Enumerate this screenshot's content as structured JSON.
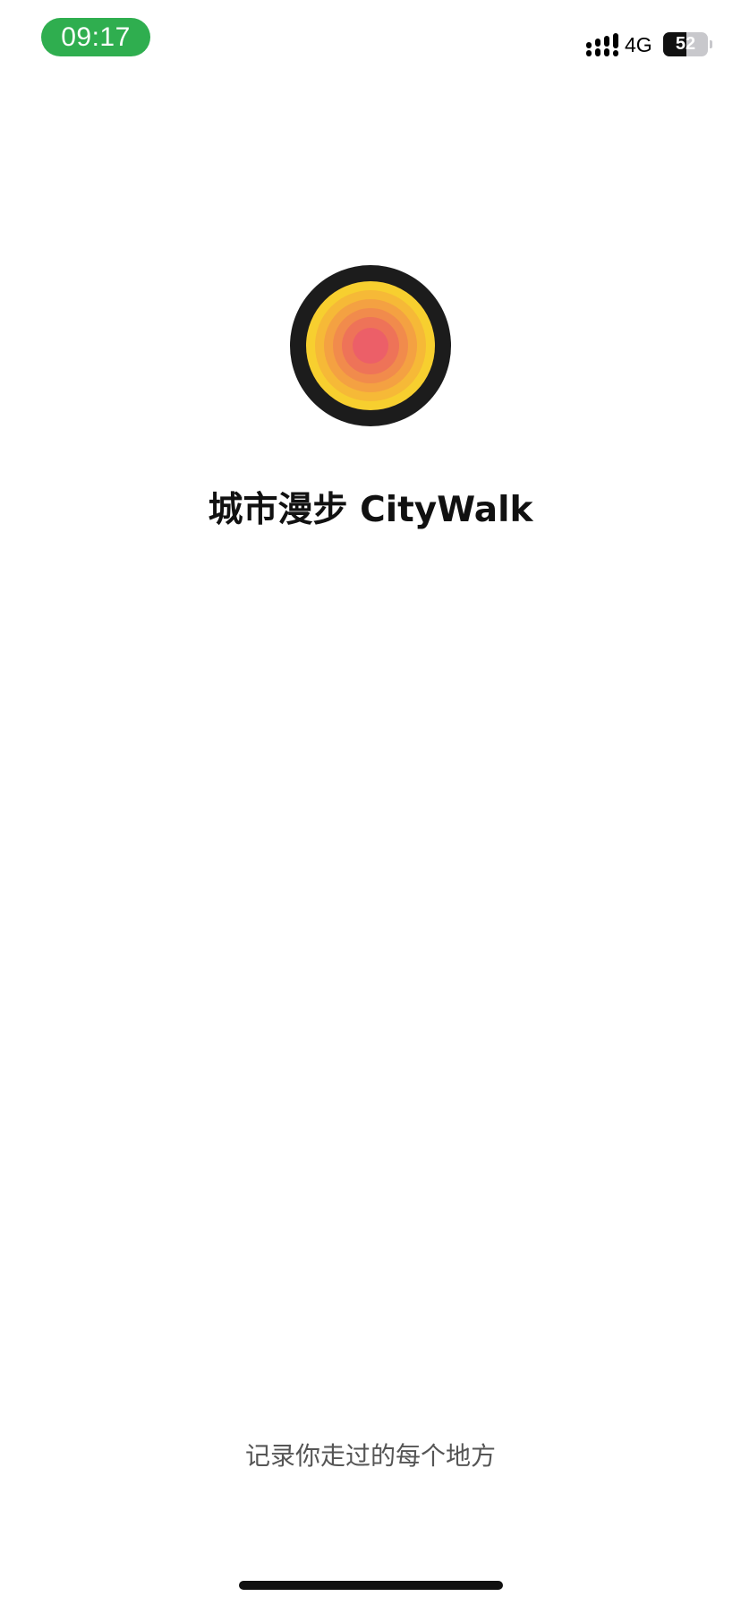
{
  "status_bar": {
    "time": "09:17",
    "network": "4G",
    "battery_level": "52",
    "battery_fraction": 0.52,
    "time_pill_color": "#2fae4f"
  },
  "splash": {
    "logo_icon": "concentric-circles-logo-icon",
    "logo_colors": [
      "#1c1c1c",
      "#f7cf2f",
      "#f6b937",
      "#f4a142",
      "#f18b4c",
      "#ee7358",
      "#ec5f68"
    ],
    "title": "城市漫步 CityWalk",
    "tagline": "记录你走过的每个地方"
  }
}
